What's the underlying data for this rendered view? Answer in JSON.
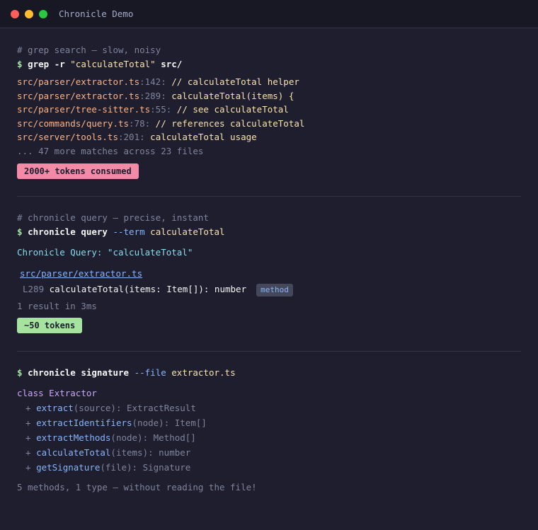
{
  "window": {
    "title": "Chronicle Demo"
  },
  "grep": {
    "comment": "# grep search — slow, noisy",
    "prompt": "$",
    "command": "grep -r",
    "query": "\"calculateTotal\"",
    "target": "src/",
    "results": [
      {
        "path": "src/parser/extractor.ts",
        "line": ":142:",
        "text": " // calculateTotal helper"
      },
      {
        "path": "src/parser/extractor.ts",
        "line": ":289:",
        "text": " calculateTotal(items) {"
      },
      {
        "path": "src/parser/tree-sitter.ts",
        "line": ":55:",
        "text": " // see calculateTotal"
      },
      {
        "path": "src/commands/query.ts",
        "line": ":78:",
        "text": " // references calculateTotal"
      },
      {
        "path": "src/server/tools.ts",
        "line": ":201:",
        "text": " calculateTotal usage"
      }
    ],
    "more": "... 47 more matches across 23 files",
    "badge": "2000+ tokens consumed"
  },
  "query": {
    "comment": "# chronicle query — precise, instant",
    "prompt": "$",
    "command": "chronicle query",
    "flag": "--term",
    "value": "calculateTotal",
    "heading": "Chronicle Query: \"calculateTotal\"",
    "file": "src/parser/extractor.ts",
    "lineno": "L289",
    "signature": "calculateTotal(items: Item[]): number",
    "kind": "method",
    "summary": "1 result in 3ms",
    "badge": "~50 tokens"
  },
  "signature": {
    "prompt": "$",
    "command": "chronicle signature",
    "flag": "--file",
    "value": "extractor.ts",
    "class_kw": "class",
    "class_name": "Extractor",
    "members": [
      {
        "name": "extract",
        "args": "(source)",
        "ret": ": ExtractResult"
      },
      {
        "name": "extractIdentifiers",
        "args": "(node)",
        "ret": ": Item[]"
      },
      {
        "name": "extractMethods",
        "args": "(node)",
        "ret": ": Method[]"
      },
      {
        "name": "calculateTotal",
        "args": "(items)",
        "ret": ": number"
      },
      {
        "name": "getSignature",
        "args": "(file)",
        "ret": ": Signature"
      }
    ],
    "plus": "+",
    "summary": "5 methods, 1 type — without reading the file!"
  },
  "colors": {
    "background": "#1e1e2e",
    "prompt": "#a6e3a1",
    "path": "#fab387",
    "badge_pink": "#f38ba8",
    "badge_green": "#a6e3a1"
  }
}
